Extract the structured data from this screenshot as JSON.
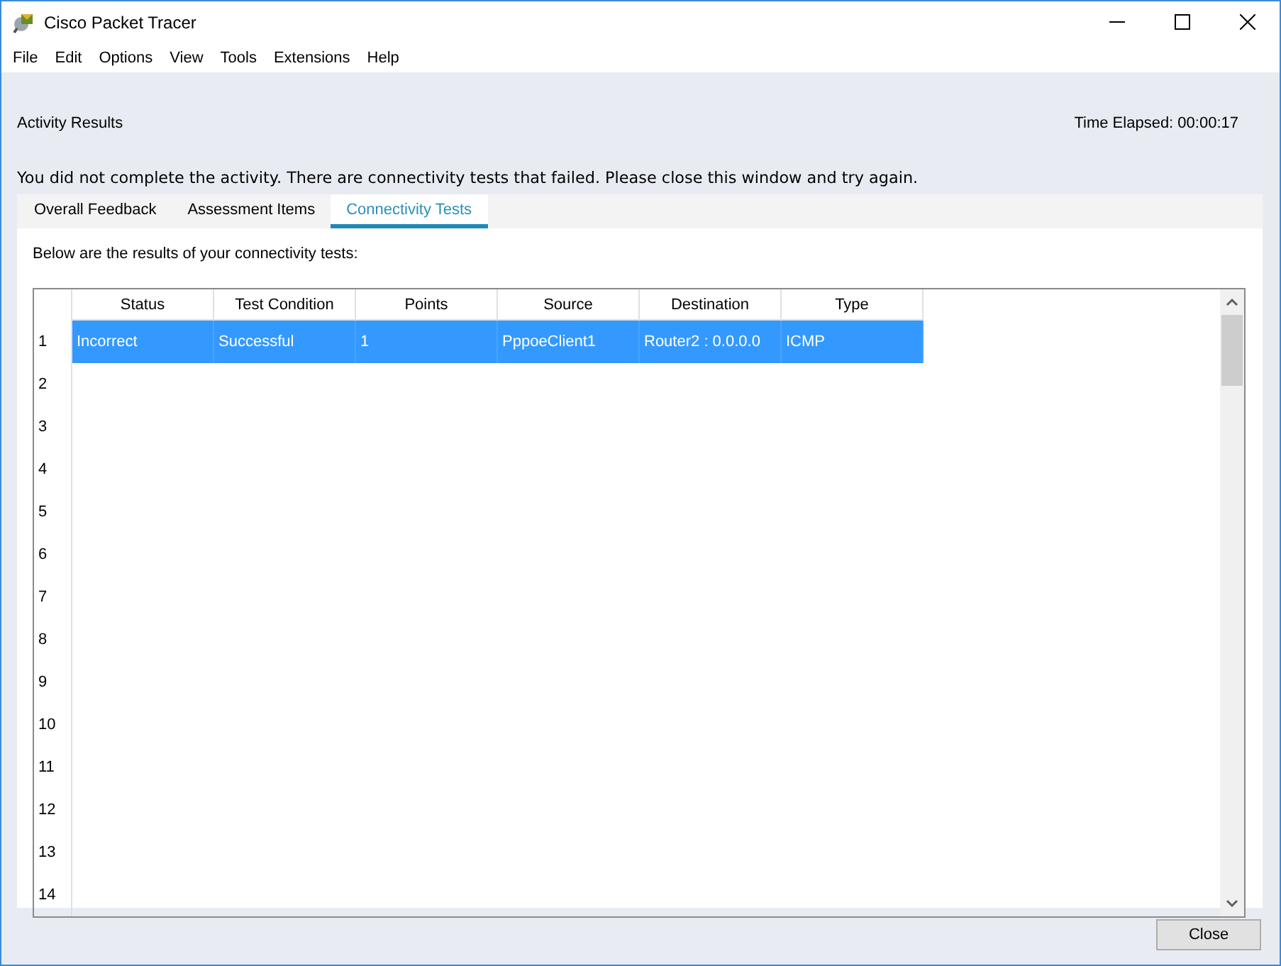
{
  "window": {
    "title": "Cisco Packet Tracer"
  },
  "menu": [
    "File",
    "Edit",
    "Options",
    "View",
    "Tools",
    "Extensions",
    "Help"
  ],
  "heading": "Activity Results",
  "time_elapsed": "Time Elapsed: 00:00:17",
  "message": "You did not complete the activity. There are connectivity tests that failed. Please close this window and try again.",
  "tabs": [
    {
      "label": "Overall Feedback",
      "selected": false
    },
    {
      "label": "Assessment Items",
      "selected": false
    },
    {
      "label": "Connectivity Tests",
      "selected": true
    }
  ],
  "caption": "Below are the results of your connectivity tests:",
  "table": {
    "columns": [
      "Status",
      "Test Condition",
      "Points",
      "Source",
      "Destination",
      "Type"
    ],
    "rows": [
      {
        "number": "1",
        "selected": true,
        "cells": [
          "Incorrect",
          "Successful",
          "1",
          "PppoeClient1",
          "Router2 : 0.0.0.0",
          "ICMP"
        ]
      },
      {
        "number": "2",
        "selected": false
      },
      {
        "number": "3",
        "selected": false
      },
      {
        "number": "4",
        "selected": false
      },
      {
        "number": "5",
        "selected": false
      },
      {
        "number": "6",
        "selected": false
      },
      {
        "number": "7",
        "selected": false
      },
      {
        "number": "8",
        "selected": false
      },
      {
        "number": "9",
        "selected": false
      },
      {
        "number": "10",
        "selected": false
      },
      {
        "number": "11",
        "selected": false
      },
      {
        "number": "12",
        "selected": false
      },
      {
        "number": "13",
        "selected": false
      },
      {
        "number": "14",
        "selected": false
      }
    ]
  },
  "buttons": [
    "Close"
  ]
}
